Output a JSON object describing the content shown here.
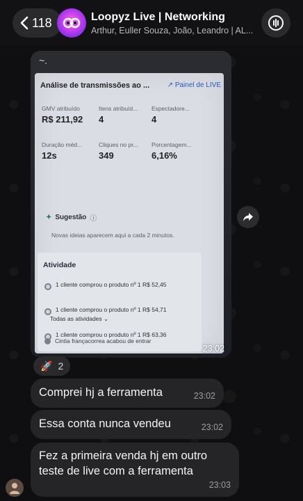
{
  "header": {
    "back_count": "118",
    "title": "Loopyz Live | Networking",
    "subtitle": "Arthur, Euller Souza, João, Leandro | AL..."
  },
  "photo_message": {
    "top_text": "~.",
    "time": "23:02",
    "screen": {
      "title": "Análise de transmissões ao ...",
      "panel_link": "Painel de LIVE",
      "stats": [
        {
          "label": "GMV atribuído",
          "value": "R$ 211,92"
        },
        {
          "label": "Itens atribuíd...",
          "value": "4"
        },
        {
          "label": "Espectadore...",
          "value": "4"
        },
        {
          "label": "Duração méd...",
          "value": "12s"
        },
        {
          "label": "Cliques no pr...",
          "value": "349"
        },
        {
          "label": "Porcentagem...",
          "value": "6,16%"
        }
      ],
      "suggestion_label": "Sugestão",
      "suggestion_note": "Novas ideias aparecem aqui a cada 2 minutos.",
      "activity_title": "Atividade",
      "activities": [
        {
          "text": "1 cliente comprou o produto nº 1    R$ 52,45"
        },
        {
          "text": "1 cliente comprou o produto nº 1    R$ 54,71"
        },
        {
          "text": "1 cliente comprou o produto nº 1    R$ 63,36"
        }
      ],
      "all_activities": "Todas as atividades",
      "last_event": "Cintia françacorrea acabou de entrar"
    }
  },
  "reaction": {
    "emoji": "🚀",
    "count": "2"
  },
  "messages": [
    {
      "text": "Comprei hj a ferramenta",
      "time": "23:02"
    },
    {
      "text": "Essa conta nunca vendeu",
      "time": "23:02"
    },
    {
      "text": "Fez a primeira venda hj em outro teste de live com a ferramenta",
      "time": "23:03"
    }
  ]
}
